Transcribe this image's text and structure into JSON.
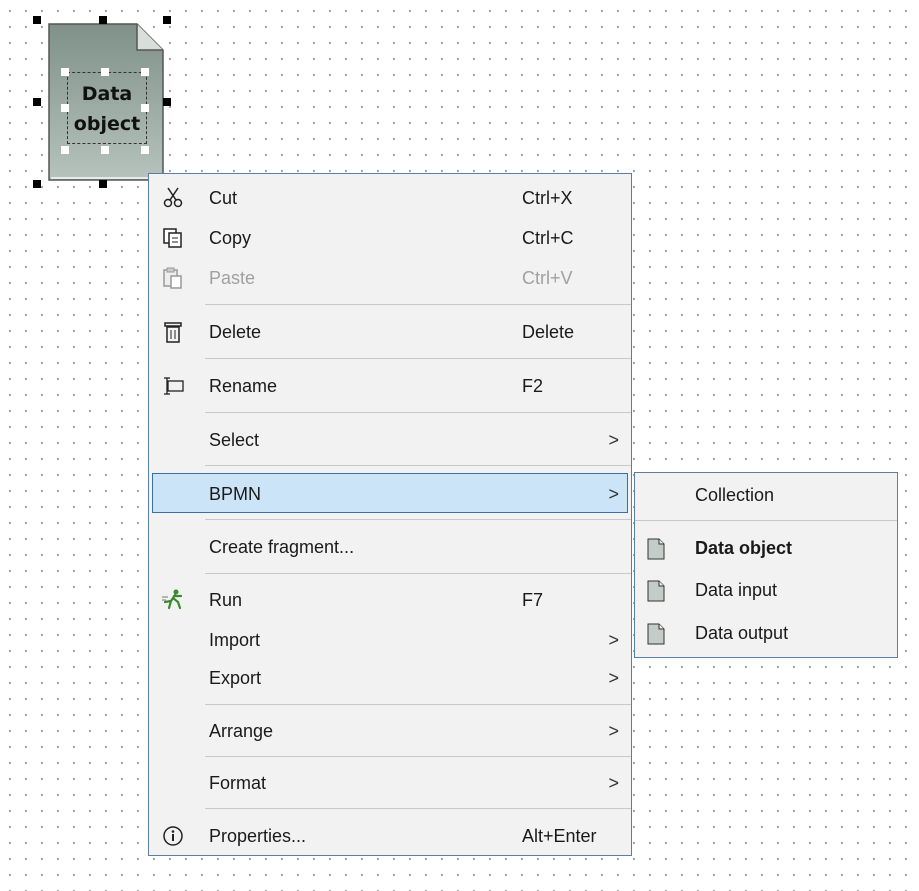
{
  "canvas": {
    "shape_label_line1": "Data",
    "shape_label_line2": "object"
  },
  "context_menu": {
    "items": [
      {
        "label": "Cut",
        "shortcut": "Ctrl+X",
        "icon": "scissors-icon"
      },
      {
        "label": "Copy",
        "shortcut": "Ctrl+C",
        "icon": "copy-icon"
      },
      {
        "label": "Paste",
        "shortcut": "Ctrl+V",
        "icon": "paste-icon",
        "disabled": true
      },
      {
        "label": "Delete",
        "shortcut": "Delete",
        "icon": "trash-icon"
      },
      {
        "label": "Rename",
        "shortcut": "F2",
        "icon": "rename-icon"
      },
      {
        "label": "Select",
        "submenu_arrow": ">"
      },
      {
        "label": "BPMN",
        "submenu_arrow": ">",
        "highlighted": true
      },
      {
        "label": "Create fragment..."
      },
      {
        "label": "Run",
        "shortcut": "F7",
        "icon": "run-icon"
      },
      {
        "label": "Import",
        "submenu_arrow": ">"
      },
      {
        "label": "Export",
        "submenu_arrow": ">"
      },
      {
        "label": "Arrange",
        "submenu_arrow": ">"
      },
      {
        "label": "Format",
        "submenu_arrow": ">"
      },
      {
        "label": "Properties...",
        "shortcut": "Alt+Enter",
        "icon": "info-icon"
      }
    ]
  },
  "bpmn_submenu": {
    "items": [
      {
        "label": "Collection"
      },
      {
        "label": "Data object",
        "icon": "data-object-icon",
        "bold": true
      },
      {
        "label": "Data input",
        "icon": "data-object-icon"
      },
      {
        "label": "Data output",
        "icon": "data-object-icon"
      }
    ]
  },
  "colors": {
    "menu_border": "#5a7fa2",
    "highlight_bg": "#cce4f7",
    "highlight_border": "#3a6ea5",
    "menu_bg": "#f2f2f2"
  }
}
